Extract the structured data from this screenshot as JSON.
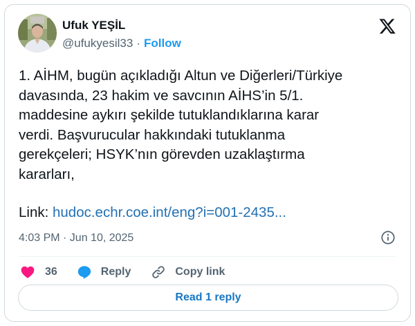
{
  "author": {
    "name": "Ufuk YEŞİL",
    "handle": "@ufukyesil33",
    "separator": "·",
    "follow_label": "Follow"
  },
  "tweet": {
    "text": "1. AİHM, bugün açıkladığı Altun ve Diğerleri/Türkiye\ndavasında, 23 hakim ve savcının AİHS’in 5/1.\nmaddesine aykırı şekilde tutuklandıklarına karar\nverdi. Başvurucular hakkındaki tutuklanma\ngerekçeleri; HSYK’nın görevden uzaklaştırma\nkararları,",
    "link_prefix": "Link: ",
    "link_text": "hudoc.echr.coe.int/eng?i=001-2435..."
  },
  "meta": {
    "timestamp": "4:03 PM · Jun 10, 2025"
  },
  "actions": {
    "like_count": "36",
    "reply_label": "Reply",
    "copy_label": "Copy link"
  },
  "read_reply_label": "Read 1 reply",
  "icons": {
    "logo": "x-logo-icon",
    "info": "info-icon",
    "like": "heart-icon",
    "reply": "speech-bubble-icon",
    "copy": "link-icon"
  },
  "colors": {
    "accent": "#1d9bf0",
    "like": "#f91880",
    "text": "#0f1419",
    "muted": "#536471",
    "border": "#cfd9de"
  }
}
